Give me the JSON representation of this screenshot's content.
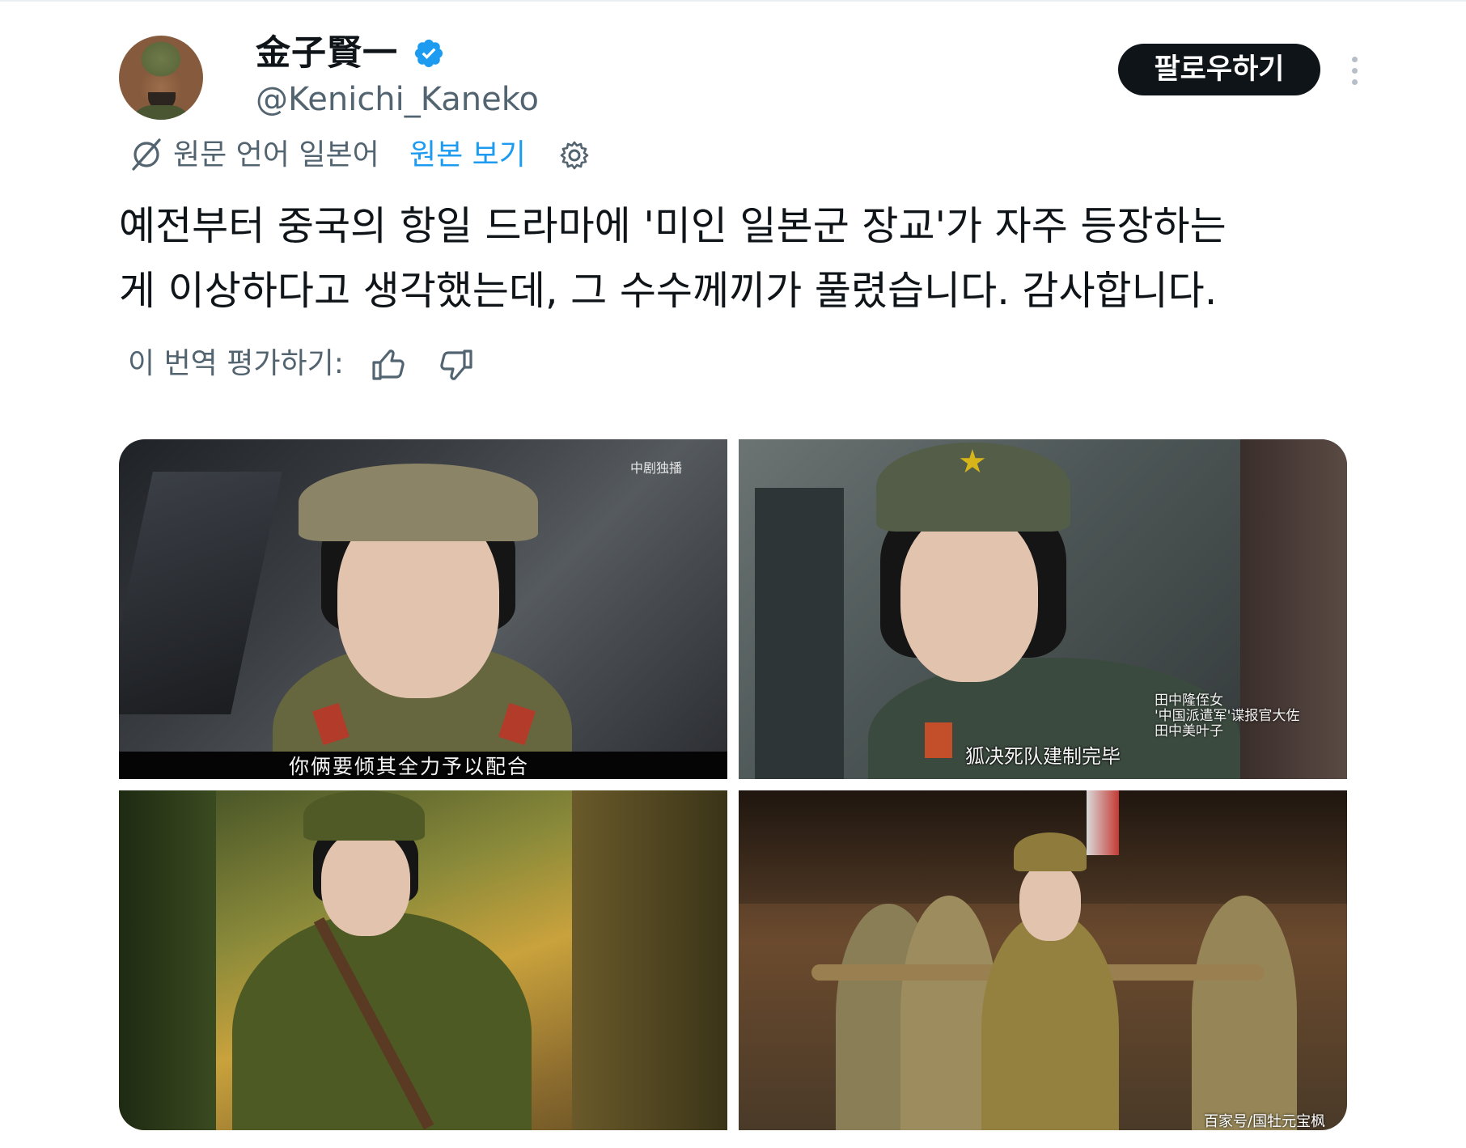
{
  "tweet": {
    "author_name": "金子賢一",
    "author_handle": "@Kenichi_Kaneko",
    "verified": true,
    "follow_label": "팔로우하기",
    "translation": {
      "note": "원문 언어 일본어",
      "show_original": "원본 보기"
    },
    "text_lines": [
      "예전부터 중국의 항일 드라마에 '미인 일본군 장교'가 자주 등장하는",
      "게 이상하다고 생각했는데, 그 수수께끼가 풀렸습니다. 감사합니다."
    ],
    "rate_label": "이 번역 평가하기:"
  },
  "media": {
    "photo1": {
      "logo_text": "中剧独播",
      "subtitle": "你俩要倾其全力予以配合"
    },
    "photo2": {
      "caption_lines": [
        "田中隆侄女",
        "'中国派遣军'谍报官大佐",
        "田中美叶子"
      ],
      "subtitle": "狐决死队建制完毕"
    },
    "photo4": {
      "watermark": "百家号/国牡元宝枫"
    }
  },
  "icons": {
    "verified": "verified-badge-icon",
    "more": "more-options-icon",
    "translate": "translate-icon",
    "settings": "gear-icon",
    "thumbs_up": "thumbs-up-icon",
    "thumbs_down": "thumbs-down-icon"
  },
  "colors": {
    "text_primary": "#0f1419",
    "text_secondary": "#536471",
    "link": "#1d9bf0",
    "verified": "#1d9bf0",
    "button_bg": "#0f1419"
  }
}
